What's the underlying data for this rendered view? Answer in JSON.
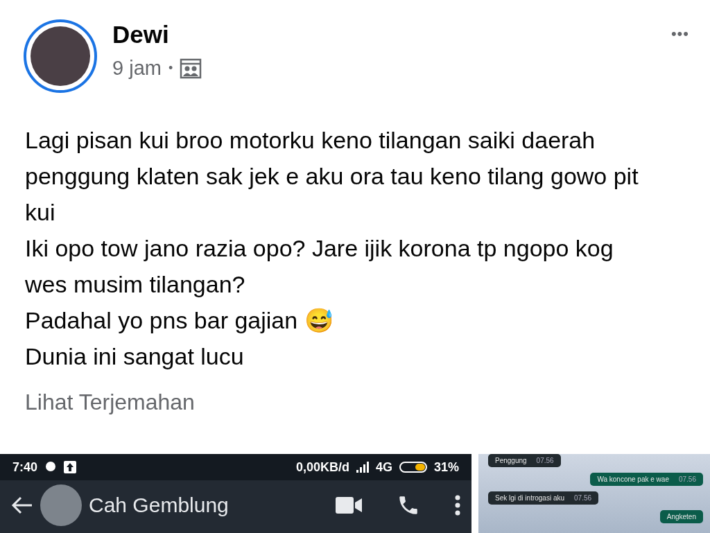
{
  "post": {
    "author": "Dewi",
    "time": "9 jam",
    "separator": "•",
    "more": "•••",
    "lines": [
      "Lagi pisan kui broo motorku keno tilangan saiki daerah penggung klaten sak jek e aku ora tau keno tilang gowo pit kui",
      "Iki opo tow jano razia opo? Jare ijik korona tp ngopo kog wes musim tilangan?",
      "Padahal yo pns bar gajian 😅",
      "Dunia ini sangat lucu"
    ],
    "translate": "Lihat Terjemahan"
  },
  "chat_screenshot": {
    "status_time": "7:40",
    "network_speed": "0,00KB/d",
    "network_type": "4G",
    "battery": "31%",
    "contact": "Cah Gemblung"
  },
  "chat_photo": {
    "messages": [
      {
        "text": "Penggung",
        "time": "07.56",
        "outgoing": false
      },
      {
        "text": "Wa koncone pak e wae",
        "time": "07.56",
        "outgoing": true
      },
      {
        "text": "Sek lgi di introgasi aku",
        "time": "07.56",
        "outgoing": false
      },
      {
        "text": "Angketen",
        "outgoing": true
      }
    ]
  }
}
